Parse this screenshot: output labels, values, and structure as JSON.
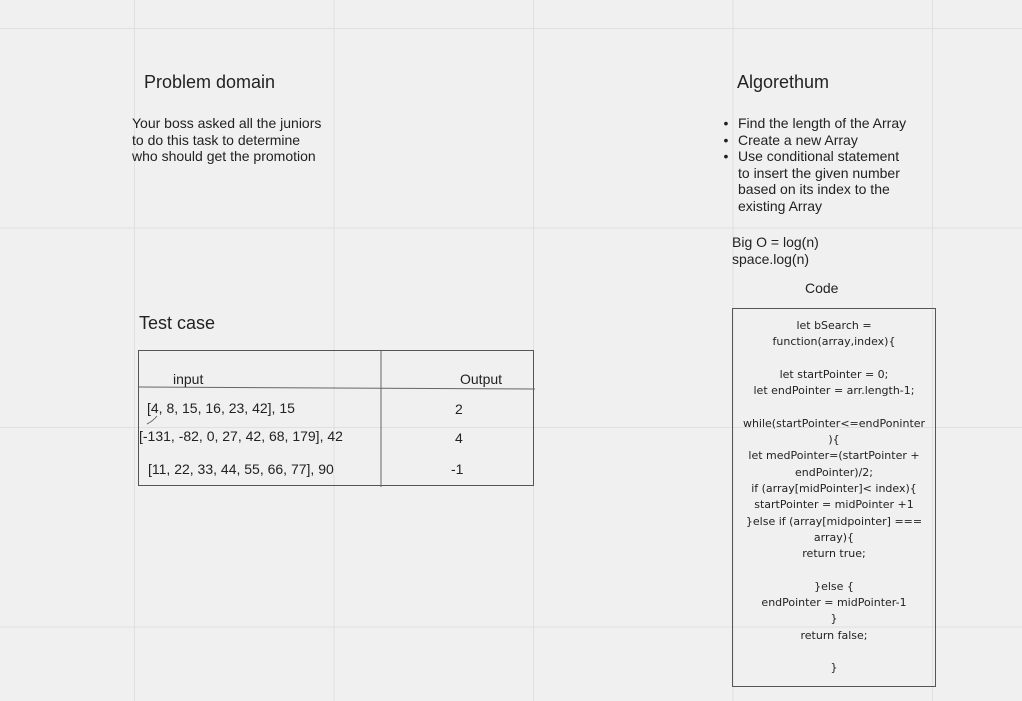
{
  "problem_domain": {
    "heading": "Problem domain",
    "text": "Your boss asked all the juniors\nto do this task to determine\nwho should get the promotion"
  },
  "algorithm": {
    "heading": "Algorethum",
    "steps": [
      "Find the length of the Array",
      "Create a new Array",
      "Use conditional statement\nto insert the given number\nbased on its index to the\nexisting Array"
    ],
    "big_o": "Big O =  log(n)\nspace.log(n)"
  },
  "test_case": {
    "heading": "Test case",
    "columns": [
      "input",
      "Output"
    ],
    "rows": [
      {
        "input": "[4, 8, 15, 16, 23, 42], 15",
        "output": "2"
      },
      {
        "input": "[-131, -82, 0, 27, 42, 68, 179], 42",
        "output": "4"
      },
      {
        "input": "[11, 22, 33, 44, 55, 66, 77], 90",
        "output": "-1"
      }
    ]
  },
  "code": {
    "heading": "Code",
    "text": "let bSearch =\nfunction(array,index){\n\nlet startPointer = 0;\nlet endPointer = arr.length-1;\n\nwhile(startPointer<=endPoninter\n){\nlet medPointer=(startPointer +\nendPointer)/2;\nif (array[midPointer]< index){\nstartPointer = midPointer +1\n}else if (array[midpointer] ===\narray){\nreturn true;\n\n}else {\nendPointer = midPointer-1\n}\nreturn false;\n\n}"
  },
  "colors": {
    "background": "#f0f0f0",
    "grid": "#e0e0e0",
    "border": "#555555",
    "text": "#222222"
  }
}
